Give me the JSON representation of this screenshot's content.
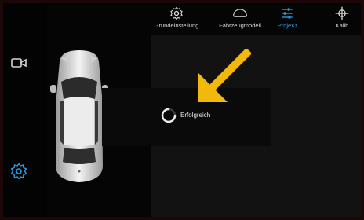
{
  "nav_tabs": [
    {
      "label": "Grundeinstellung",
      "icon": "gear-icon"
    },
    {
      "label": "Fahrzeugmodell",
      "icon": "car-outline-icon"
    },
    {
      "label": "ProjeKt",
      "icon": "sliders-icon",
      "active": true
    },
    {
      "label": "Kalib",
      "icon": "crosshair-icon"
    }
  ],
  "sidebar": {
    "icons": [
      "camera-icon",
      "settings-gear-icon"
    ]
  },
  "toast": {
    "message": "Erfolgreich",
    "icon": "loading-spinner-icon"
  },
  "colors": {
    "accent": "#2aa0e6",
    "arrow": "#f2b90c",
    "background": "#070707",
    "frame": "#1c0608"
  }
}
